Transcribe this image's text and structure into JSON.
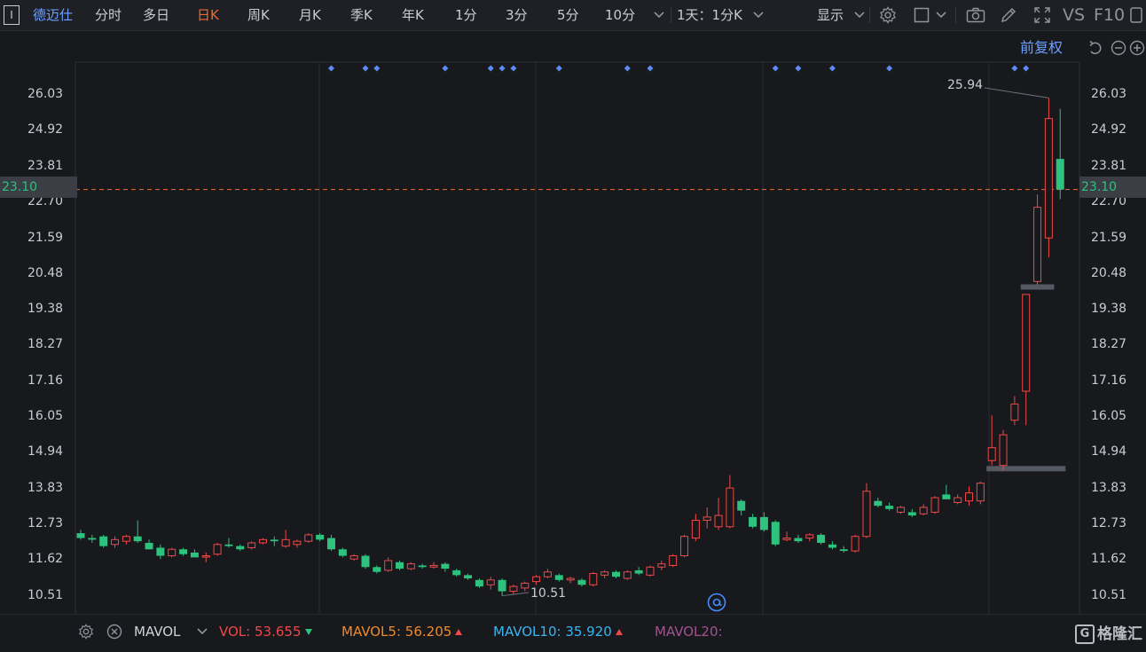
{
  "header": {
    "symbol_box": "I",
    "stock_name": "德迈仕",
    "periods": [
      "分时",
      "多日",
      "日K",
      "周K",
      "月K",
      "季K",
      "年K",
      "1分",
      "3分",
      "5分",
      "10分"
    ],
    "active_period": "日K",
    "interval_select": "1天：1分K",
    "display_label": "显示",
    "vs_label": "VS",
    "f10_label": "F10"
  },
  "adjust_label": "前复权",
  "colors": {
    "up": "#f04848",
    "down": "#2ec27e",
    "accent": "#f26b2c",
    "blue": "#6ea0ff",
    "bg": "#18191d"
  },
  "chart_data": {
    "type": "candlestick",
    "y_ticks": [
      "26.03",
      "24.92",
      "23.81",
      "22.70",
      "21.59",
      "20.48",
      "19.38",
      "18.27",
      "17.16",
      "16.05",
      "14.94",
      "13.83",
      "12.73",
      "11.62",
      "10.51"
    ],
    "ylim": [
      9.95,
      27.05
    ],
    "current_price": "23.10",
    "current_price_value": 23.1,
    "max_label": "25.94",
    "max_value": 25.94,
    "min_label": "10.51",
    "min_value": 10.51,
    "grid": true,
    "candles": [
      {
        "o": 12.45,
        "h": 12.55,
        "l": 12.25,
        "c": 12.3
      },
      {
        "o": 12.3,
        "h": 12.4,
        "l": 12.15,
        "c": 12.25
      },
      {
        "o": 12.35,
        "h": 12.4,
        "l": 12.0,
        "c": 12.05
      },
      {
        "o": 12.1,
        "h": 12.35,
        "l": 12.0,
        "c": 12.25
      },
      {
        "o": 12.2,
        "h": 12.4,
        "l": 12.1,
        "c": 12.35
      },
      {
        "o": 12.35,
        "h": 12.85,
        "l": 12.15,
        "c": 12.2
      },
      {
        "o": 12.15,
        "h": 12.25,
        "l": 11.95,
        "c": 11.95
      },
      {
        "o": 12.0,
        "h": 12.1,
        "l": 11.65,
        "c": 11.75
      },
      {
        "o": 11.75,
        "h": 12.0,
        "l": 11.7,
        "c": 11.95
      },
      {
        "o": 11.95,
        "h": 12.0,
        "l": 11.75,
        "c": 11.8
      },
      {
        "o": 11.85,
        "h": 11.95,
        "l": 11.7,
        "c": 11.7
      },
      {
        "o": 11.75,
        "h": 11.85,
        "l": 11.55,
        "c": 11.75
      },
      {
        "o": 11.8,
        "h": 12.15,
        "l": 11.75,
        "c": 12.1
      },
      {
        "o": 12.1,
        "h": 12.3,
        "l": 12.0,
        "c": 12.05
      },
      {
        "o": 12.05,
        "h": 12.1,
        "l": 11.9,
        "c": 11.95
      },
      {
        "o": 12.0,
        "h": 12.2,
        "l": 11.95,
        "c": 12.15
      },
      {
        "o": 12.15,
        "h": 12.3,
        "l": 12.1,
        "c": 12.25
      },
      {
        "o": 12.25,
        "h": 12.35,
        "l": 12.05,
        "c": 12.2
      },
      {
        "o": 12.05,
        "h": 12.55,
        "l": 12.0,
        "c": 12.25
      },
      {
        "o": 12.1,
        "h": 12.25,
        "l": 12.0,
        "c": 12.2
      },
      {
        "o": 12.2,
        "h": 12.45,
        "l": 12.15,
        "c": 12.4
      },
      {
        "o": 12.4,
        "h": 12.45,
        "l": 12.2,
        "c": 12.25
      },
      {
        "o": 12.3,
        "h": 12.4,
        "l": 11.9,
        "c": 11.95
      },
      {
        "o": 11.95,
        "h": 12.0,
        "l": 11.7,
        "c": 11.75
      },
      {
        "o": 11.65,
        "h": 11.8,
        "l": 11.6,
        "c": 11.75
      },
      {
        "o": 11.75,
        "h": 11.8,
        "l": 11.35,
        "c": 11.4
      },
      {
        "o": 11.4,
        "h": 11.45,
        "l": 11.2,
        "c": 11.25
      },
      {
        "o": 11.3,
        "h": 11.7,
        "l": 11.25,
        "c": 11.6
      },
      {
        "o": 11.55,
        "h": 11.6,
        "l": 11.3,
        "c": 11.35
      },
      {
        "o": 11.35,
        "h": 11.55,
        "l": 11.3,
        "c": 11.5
      },
      {
        "o": 11.45,
        "h": 11.5,
        "l": 11.35,
        "c": 11.4
      },
      {
        "o": 11.4,
        "h": 11.55,
        "l": 11.35,
        "c": 11.45
      },
      {
        "o": 11.5,
        "h": 11.55,
        "l": 11.25,
        "c": 11.35
      },
      {
        "o": 11.3,
        "h": 11.35,
        "l": 11.1,
        "c": 11.15
      },
      {
        "o": 11.15,
        "h": 11.2,
        "l": 11.0,
        "c": 11.05
      },
      {
        "o": 11.0,
        "h": 11.05,
        "l": 10.75,
        "c": 10.8
      },
      {
        "o": 10.85,
        "h": 11.1,
        "l": 10.7,
        "c": 11.0
      },
      {
        "o": 11.0,
        "h": 11.05,
        "l": 10.51,
        "c": 10.65
      },
      {
        "o": 10.65,
        "h": 10.85,
        "l": 10.55,
        "c": 10.8
      },
      {
        "o": 10.75,
        "h": 10.95,
        "l": 10.65,
        "c": 10.9
      },
      {
        "o": 10.95,
        "h": 11.15,
        "l": 10.85,
        "c": 11.1
      },
      {
        "o": 11.1,
        "h": 11.35,
        "l": 11.05,
        "c": 11.25
      },
      {
        "o": 11.15,
        "h": 11.2,
        "l": 10.95,
        "c": 11.0
      },
      {
        "o": 11.0,
        "h": 11.1,
        "l": 10.9,
        "c": 11.05
      },
      {
        "o": 11.0,
        "h": 11.05,
        "l": 10.8,
        "c": 10.85
      },
      {
        "o": 10.85,
        "h": 11.25,
        "l": 10.8,
        "c": 11.2
      },
      {
        "o": 11.15,
        "h": 11.3,
        "l": 11.05,
        "c": 11.25
      },
      {
        "o": 11.25,
        "h": 11.3,
        "l": 11.05,
        "c": 11.1
      },
      {
        "o": 11.05,
        "h": 11.3,
        "l": 11.0,
        "c": 11.25
      },
      {
        "o": 11.3,
        "h": 11.4,
        "l": 11.15,
        "c": 11.2
      },
      {
        "o": 11.15,
        "h": 11.45,
        "l": 11.1,
        "c": 11.4
      },
      {
        "o": 11.4,
        "h": 11.6,
        "l": 11.3,
        "c": 11.5
      },
      {
        "o": 11.45,
        "h": 11.8,
        "l": 11.4,
        "c": 11.75
      },
      {
        "o": 11.75,
        "h": 12.4,
        "l": 11.7,
        "c": 12.35
      },
      {
        "o": 12.3,
        "h": 13.05,
        "l": 12.2,
        "c": 12.85
      },
      {
        "o": 12.85,
        "h": 13.25,
        "l": 12.6,
        "c": 12.95
      },
      {
        "o": 12.65,
        "h": 13.55,
        "l": 12.55,
        "c": 13.0
      },
      {
        "o": 12.65,
        "h": 14.25,
        "l": 12.6,
        "c": 13.85
      },
      {
        "o": 13.45,
        "h": 13.5,
        "l": 13.0,
        "c": 13.15
      },
      {
        "o": 12.95,
        "h": 13.05,
        "l": 12.6,
        "c": 12.65
      },
      {
        "o": 12.95,
        "h": 13.1,
        "l": 12.5,
        "c": 12.55
      },
      {
        "o": 12.8,
        "h": 12.85,
        "l": 12.05,
        "c": 12.1
      },
      {
        "o": 12.25,
        "h": 12.5,
        "l": 12.2,
        "c": 12.3
      },
      {
        "o": 12.3,
        "h": 12.4,
        "l": 12.15,
        "c": 12.2
      },
      {
        "o": 12.3,
        "h": 12.45,
        "l": 12.2,
        "c": 12.4
      },
      {
        "o": 12.4,
        "h": 12.45,
        "l": 12.1,
        "c": 12.15
      },
      {
        "o": 12.1,
        "h": 12.2,
        "l": 11.95,
        "c": 12.0
      },
      {
        "o": 11.95,
        "h": 12.05,
        "l": 11.85,
        "c": 11.9
      },
      {
        "o": 11.9,
        "h": 12.4,
        "l": 11.85,
        "c": 12.35
      },
      {
        "o": 12.35,
        "h": 14.0,
        "l": 12.3,
        "c": 13.75
      },
      {
        "o": 13.45,
        "h": 13.55,
        "l": 13.25,
        "c": 13.3
      },
      {
        "o": 13.3,
        "h": 13.4,
        "l": 13.15,
        "c": 13.2
      },
      {
        "o": 13.1,
        "h": 13.3,
        "l": 13.05,
        "c": 13.25
      },
      {
        "o": 13.1,
        "h": 13.2,
        "l": 12.95,
        "c": 13.0
      },
      {
        "o": 13.05,
        "h": 13.35,
        "l": 13.0,
        "c": 13.25
      },
      {
        "o": 13.1,
        "h": 13.6,
        "l": 13.05,
        "c": 13.55
      },
      {
        "o": 13.65,
        "h": 13.95,
        "l": 13.55,
        "c": 13.5
      },
      {
        "o": 13.4,
        "h": 13.65,
        "l": 13.35,
        "c": 13.55
      },
      {
        "o": 13.45,
        "h": 13.9,
        "l": 13.3,
        "c": 13.7
      },
      {
        "o": 13.45,
        "h": 14.05,
        "l": 13.35,
        "c": 14.0
      },
      {
        "o": 14.7,
        "h": 16.1,
        "l": 14.55,
        "c": 15.1
      },
      {
        "o": 14.55,
        "h": 15.65,
        "l": 14.4,
        "c": 15.5
      },
      {
        "o": 15.95,
        "h": 16.7,
        "l": 15.8,
        "c": 16.45
      },
      {
        "o": 16.85,
        "h": 18.6,
        "l": 15.8,
        "c": 19.85
      },
      {
        "o": 20.25,
        "h": 22.95,
        "l": 20.15,
        "c": 22.55
      },
      {
        "o": 21.6,
        "h": 25.94,
        "l": 21.0,
        "c": 25.3
      },
      {
        "o": 24.05,
        "h": 25.6,
        "l": 22.8,
        "c": 23.1
      }
    ],
    "support_lines": [
      {
        "price": 14.45,
        "from_index": 80,
        "to_index": 86
      },
      {
        "price": 20.08,
        "from_index": 83,
        "to_index": 85
      }
    ],
    "event_marker_indices": [
      22,
      25,
      26,
      32,
      36,
      37,
      38,
      42,
      48,
      50,
      61,
      63,
      66,
      71,
      82,
      83
    ]
  },
  "volume": {
    "indicator": "MAVOL",
    "vol_label": "VOL:",
    "vol_value": "53.655",
    "mavol5_label": "MAVOL5:",
    "mavol5_value": "56.205",
    "mavol10_label": "MAVOL10:",
    "mavol10_value": "35.920",
    "mavol20_label": "MAVOL20:"
  },
  "brand": "格隆汇"
}
